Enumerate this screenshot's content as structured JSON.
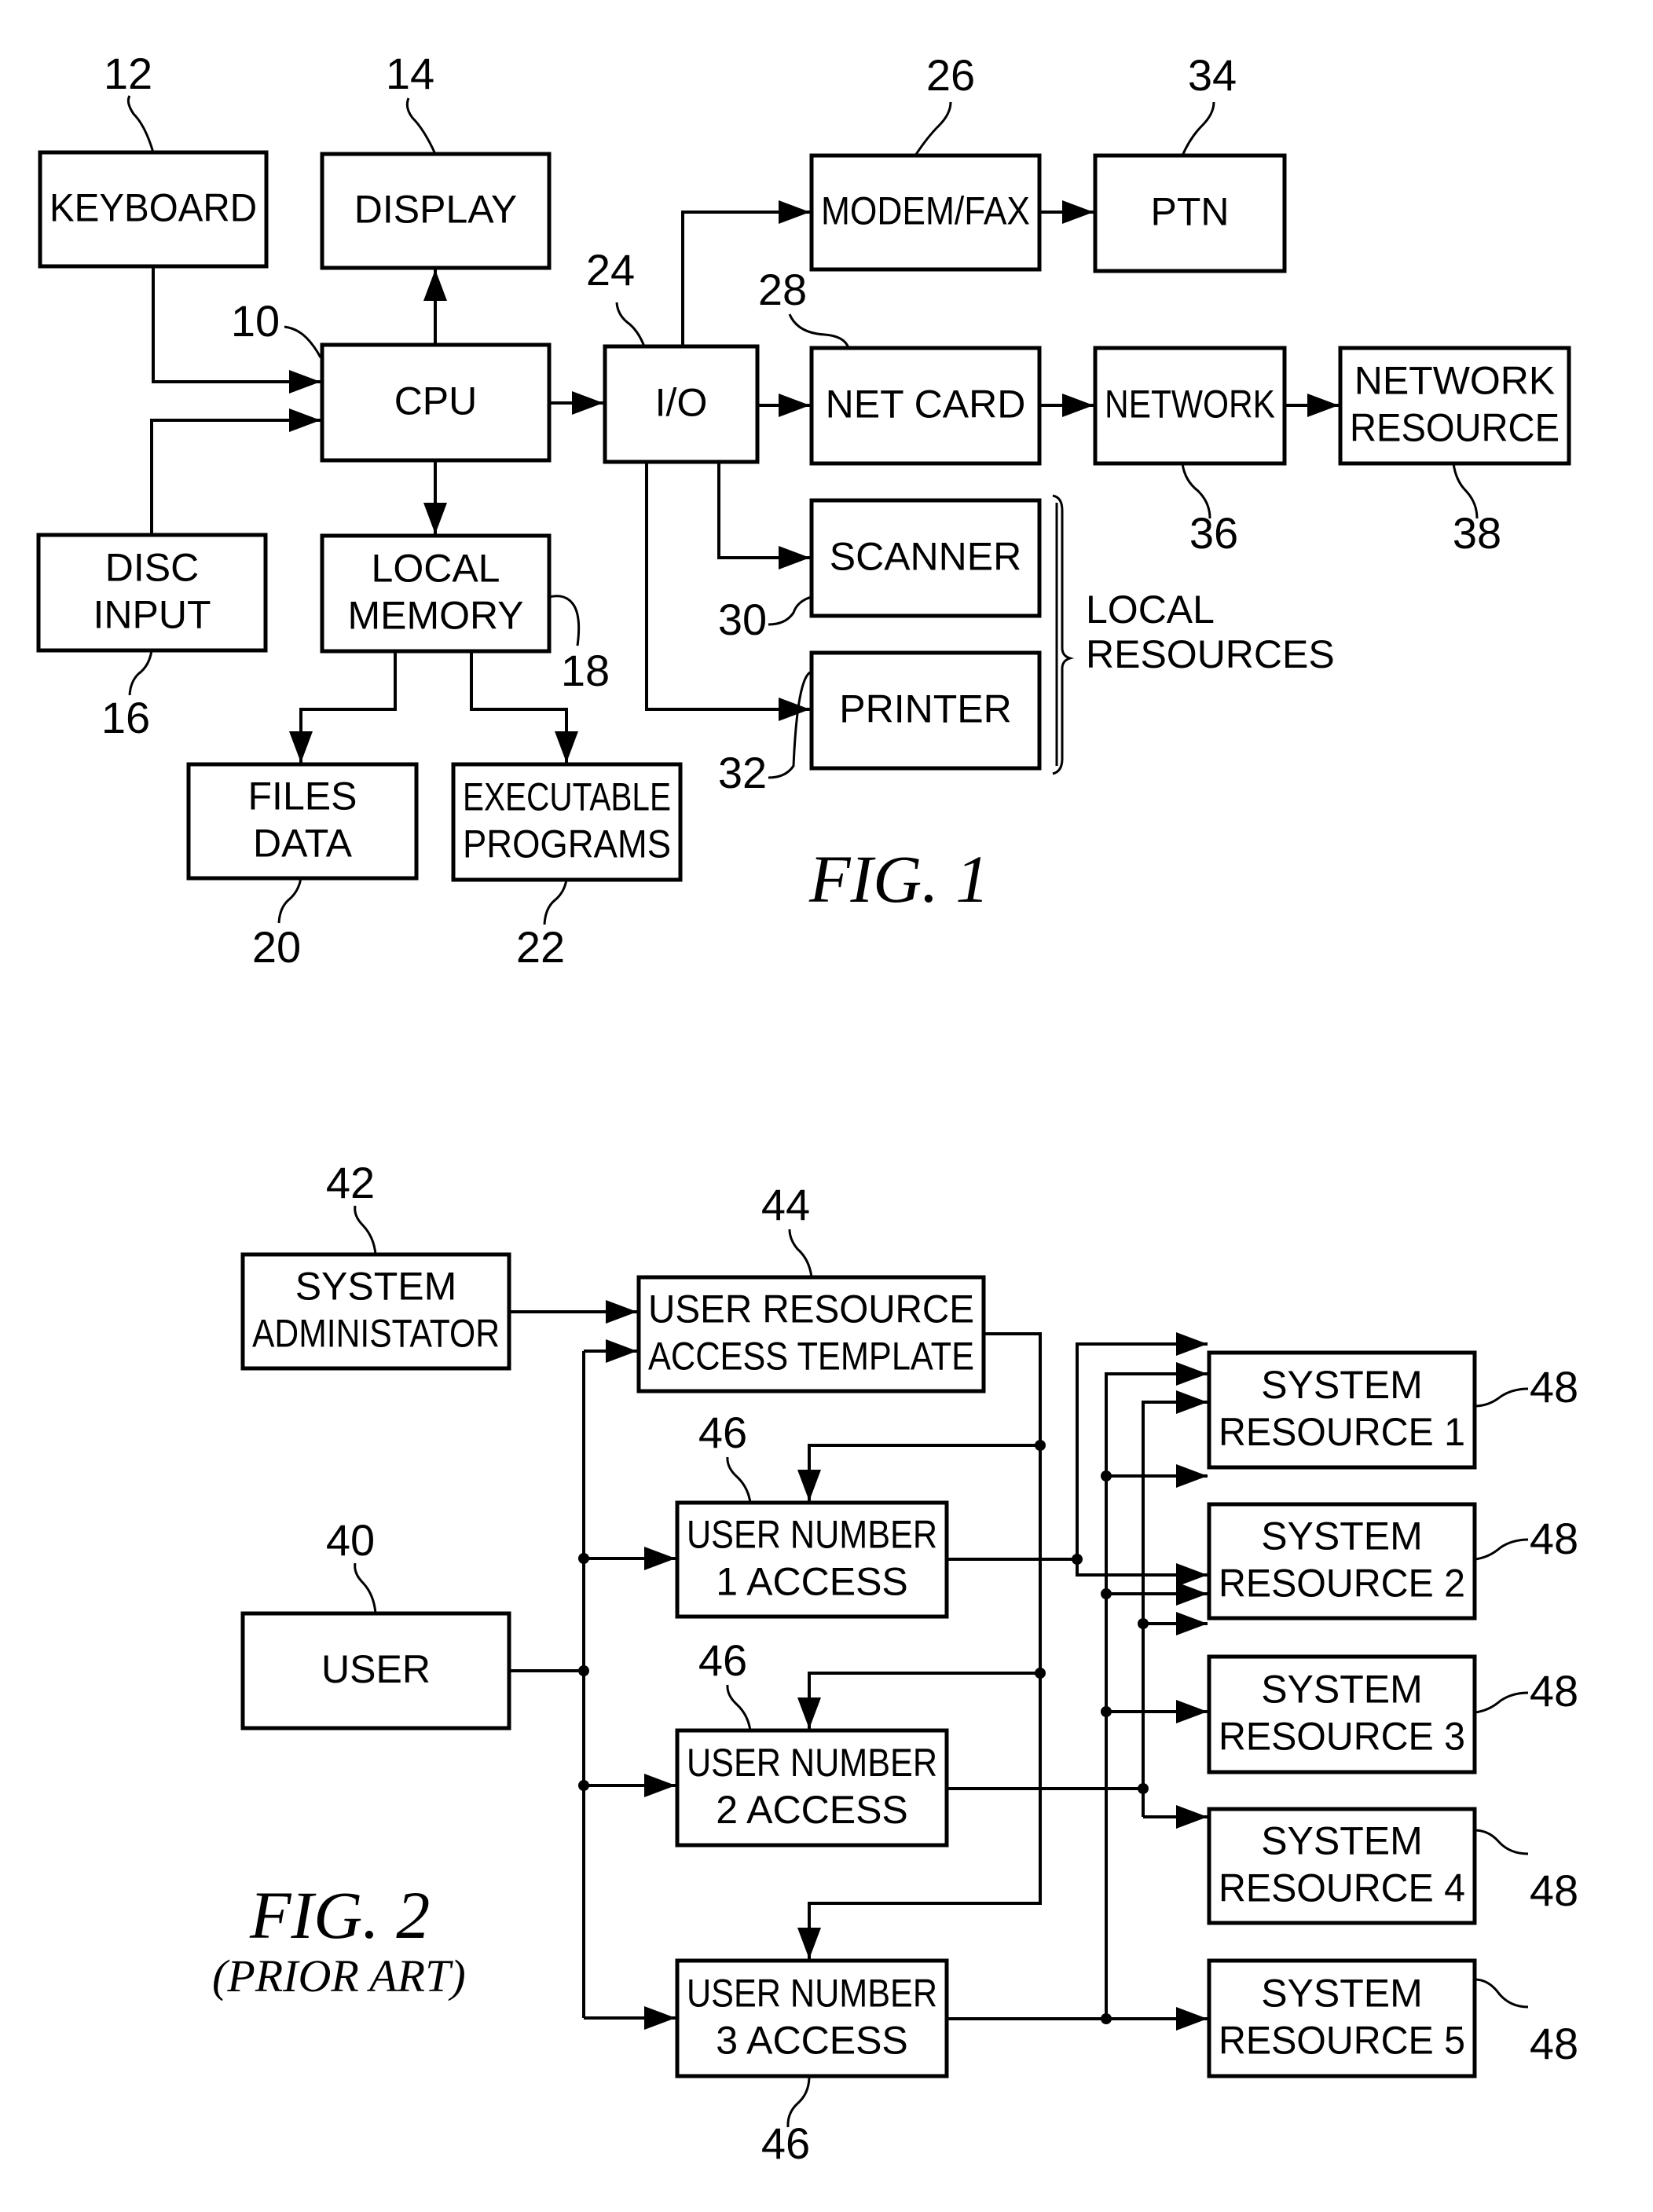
{
  "figure1": {
    "caption": "FIG.   1",
    "blocks": {
      "keyboard": {
        "lines": [
          "KEYBOARD"
        ],
        "ref": "12"
      },
      "display": {
        "lines": [
          "DISPLAY"
        ],
        "ref": "14"
      },
      "cpu": {
        "lines": [
          "CPU"
        ],
        "ref": "10"
      },
      "io": {
        "lines": [
          "I/O"
        ],
        "ref": "24"
      },
      "disc_input": {
        "lines": [
          "DISC",
          "INPUT"
        ],
        "ref": "16"
      },
      "local_memory": {
        "lines": [
          "LOCAL",
          "MEMORY"
        ],
        "ref": "18"
      },
      "files_data": {
        "lines": [
          "FILES",
          "DATA"
        ],
        "ref": "20"
      },
      "executable_programs": {
        "lines": [
          "EXECUTABLE",
          "PROGRAMS"
        ],
        "ref": "22"
      },
      "modem_fax": {
        "lines": [
          "MODEM/FAX"
        ],
        "ref": "26"
      },
      "ptn": {
        "lines": [
          "PTN"
        ],
        "ref": "34"
      },
      "net_card": {
        "lines": [
          "NET  CARD"
        ],
        "ref": "28"
      },
      "network": {
        "lines": [
          "NETWORK"
        ],
        "ref": "36"
      },
      "network_resource": {
        "lines": [
          "NETWORK",
          "RESOURCE"
        ],
        "ref": "38"
      },
      "scanner": {
        "lines": [
          "SCANNER"
        ],
        "ref": "30"
      },
      "printer": {
        "lines": [
          "PRINTER"
        ],
        "ref": "32"
      }
    },
    "local_resources_label": [
      "LOCAL",
      "RESOURCES"
    ]
  },
  "figure2": {
    "caption": "FIG.   2",
    "subcaption": "(PRIOR  ART)",
    "blocks": {
      "system_administator": {
        "lines": [
          "SYSTEM",
          "ADMINISTATOR"
        ],
        "ref": "42"
      },
      "user_resource_access_template": {
        "lines": [
          "USER  RESOURCE",
          "ACCESS  TEMPLATE"
        ],
        "ref": "44"
      },
      "user": {
        "lines": [
          "USER"
        ],
        "ref": "40"
      },
      "user_number_1_access": {
        "lines": [
          "USER  NUMBER",
          "1  ACCESS"
        ],
        "ref": "46"
      },
      "user_number_2_access": {
        "lines": [
          "USER  NUMBER",
          "2  ACCESS"
        ],
        "ref": "46"
      },
      "user_number_3_access": {
        "lines": [
          "USER  NUMBER",
          "3  ACCESS"
        ],
        "ref": "46"
      },
      "system_resource_1": {
        "lines": [
          "SYSTEM",
          "RESOURCE  1"
        ],
        "ref": "48"
      },
      "system_resource_2": {
        "lines": [
          "SYSTEM",
          "RESOURCE  2"
        ],
        "ref": "48"
      },
      "system_resource_3": {
        "lines": [
          "SYSTEM",
          "RESOURCE  3"
        ],
        "ref": "48"
      },
      "system_resource_4": {
        "lines": [
          "SYSTEM",
          "RESOURCE  4"
        ],
        "ref": "48"
      },
      "system_resource_5": {
        "lines": [
          "SYSTEM",
          "RESOURCE  5"
        ],
        "ref": "48"
      }
    }
  }
}
